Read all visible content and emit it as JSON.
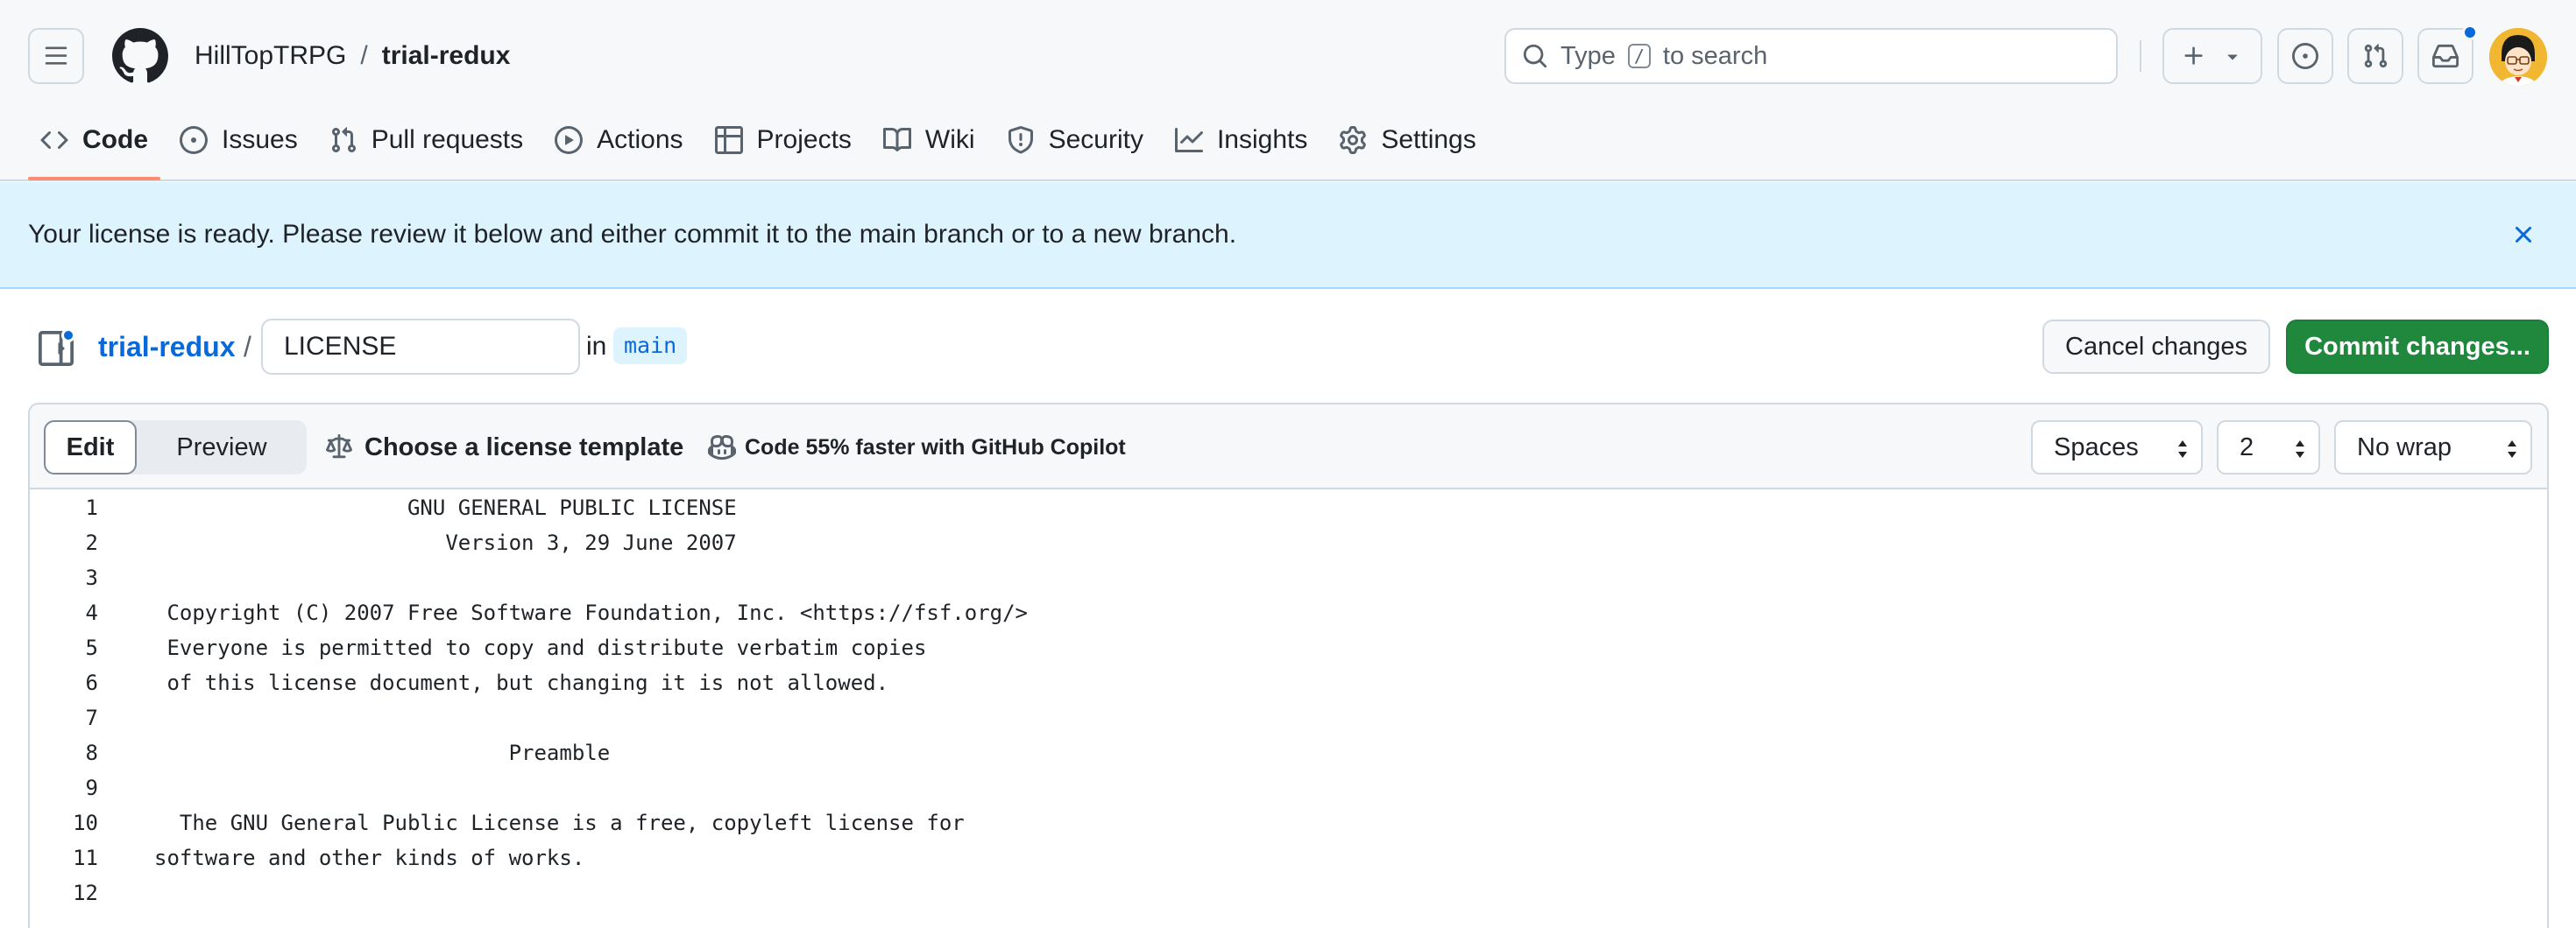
{
  "header": {
    "owner": "HillTopTRPG",
    "separator": "/",
    "repo": "trial-redux",
    "search": {
      "prefix": "Type",
      "key": "/",
      "suffix": "to search"
    }
  },
  "tabs": [
    {
      "label": "Code",
      "icon": "code-icon",
      "active": true
    },
    {
      "label": "Issues",
      "icon": "issue-opened-icon"
    },
    {
      "label": "Pull requests",
      "icon": "git-pull-request-icon"
    },
    {
      "label": "Actions",
      "icon": "play-icon"
    },
    {
      "label": "Projects",
      "icon": "table-icon"
    },
    {
      "label": "Wiki",
      "icon": "book-icon"
    },
    {
      "label": "Security",
      "icon": "shield-icon"
    },
    {
      "label": "Insights",
      "icon": "graph-icon"
    },
    {
      "label": "Settings",
      "icon": "gear-icon"
    }
  ],
  "flash": {
    "message": "Your license is ready. Please review it below and either commit it to the main branch or to a new branch."
  },
  "file_bar": {
    "repo_link": "trial-redux",
    "separator": "/",
    "filename": "LICENSE",
    "in_label": "in",
    "branch": "main",
    "cancel_label": "Cancel changes",
    "commit_label": "Commit changes..."
  },
  "editor_toolbar": {
    "edit_label": "Edit",
    "preview_label": "Preview",
    "template_label": "Choose a license template",
    "copilot_label": "Code 55% faster with GitHub Copilot",
    "indent_mode": "Spaces",
    "indent_size": "2",
    "wrap_mode": "No wrap"
  },
  "code_lines": [
    {
      "n": "1",
      "text": "                    GNU GENERAL PUBLIC LICENSE"
    },
    {
      "n": "2",
      "text": "                       Version 3, 29 June 2007"
    },
    {
      "n": "3",
      "text": ""
    },
    {
      "n": "4",
      "text": " Copyright (C) 2007 Free Software Foundation, Inc. <https://fsf.org/>"
    },
    {
      "n": "5",
      "text": " Everyone is permitted to copy and distribute verbatim copies"
    },
    {
      "n": "6",
      "text": " of this license document, but changing it is not allowed."
    },
    {
      "n": "7",
      "text": ""
    },
    {
      "n": "8",
      "text": "                            Preamble"
    },
    {
      "n": "9",
      "text": ""
    },
    {
      "n": "10",
      "text": "  The GNU General Public License is a free, copyleft license for"
    },
    {
      "n": "11",
      "text": "software and other kinds of works."
    },
    {
      "n": "12",
      "text": ""
    }
  ],
  "colors": {
    "accent_blue": "#0969da",
    "commit_green": "#1f883d",
    "active_tab_underline": "#fd8c73",
    "flash_bg": "#ddf4ff"
  }
}
